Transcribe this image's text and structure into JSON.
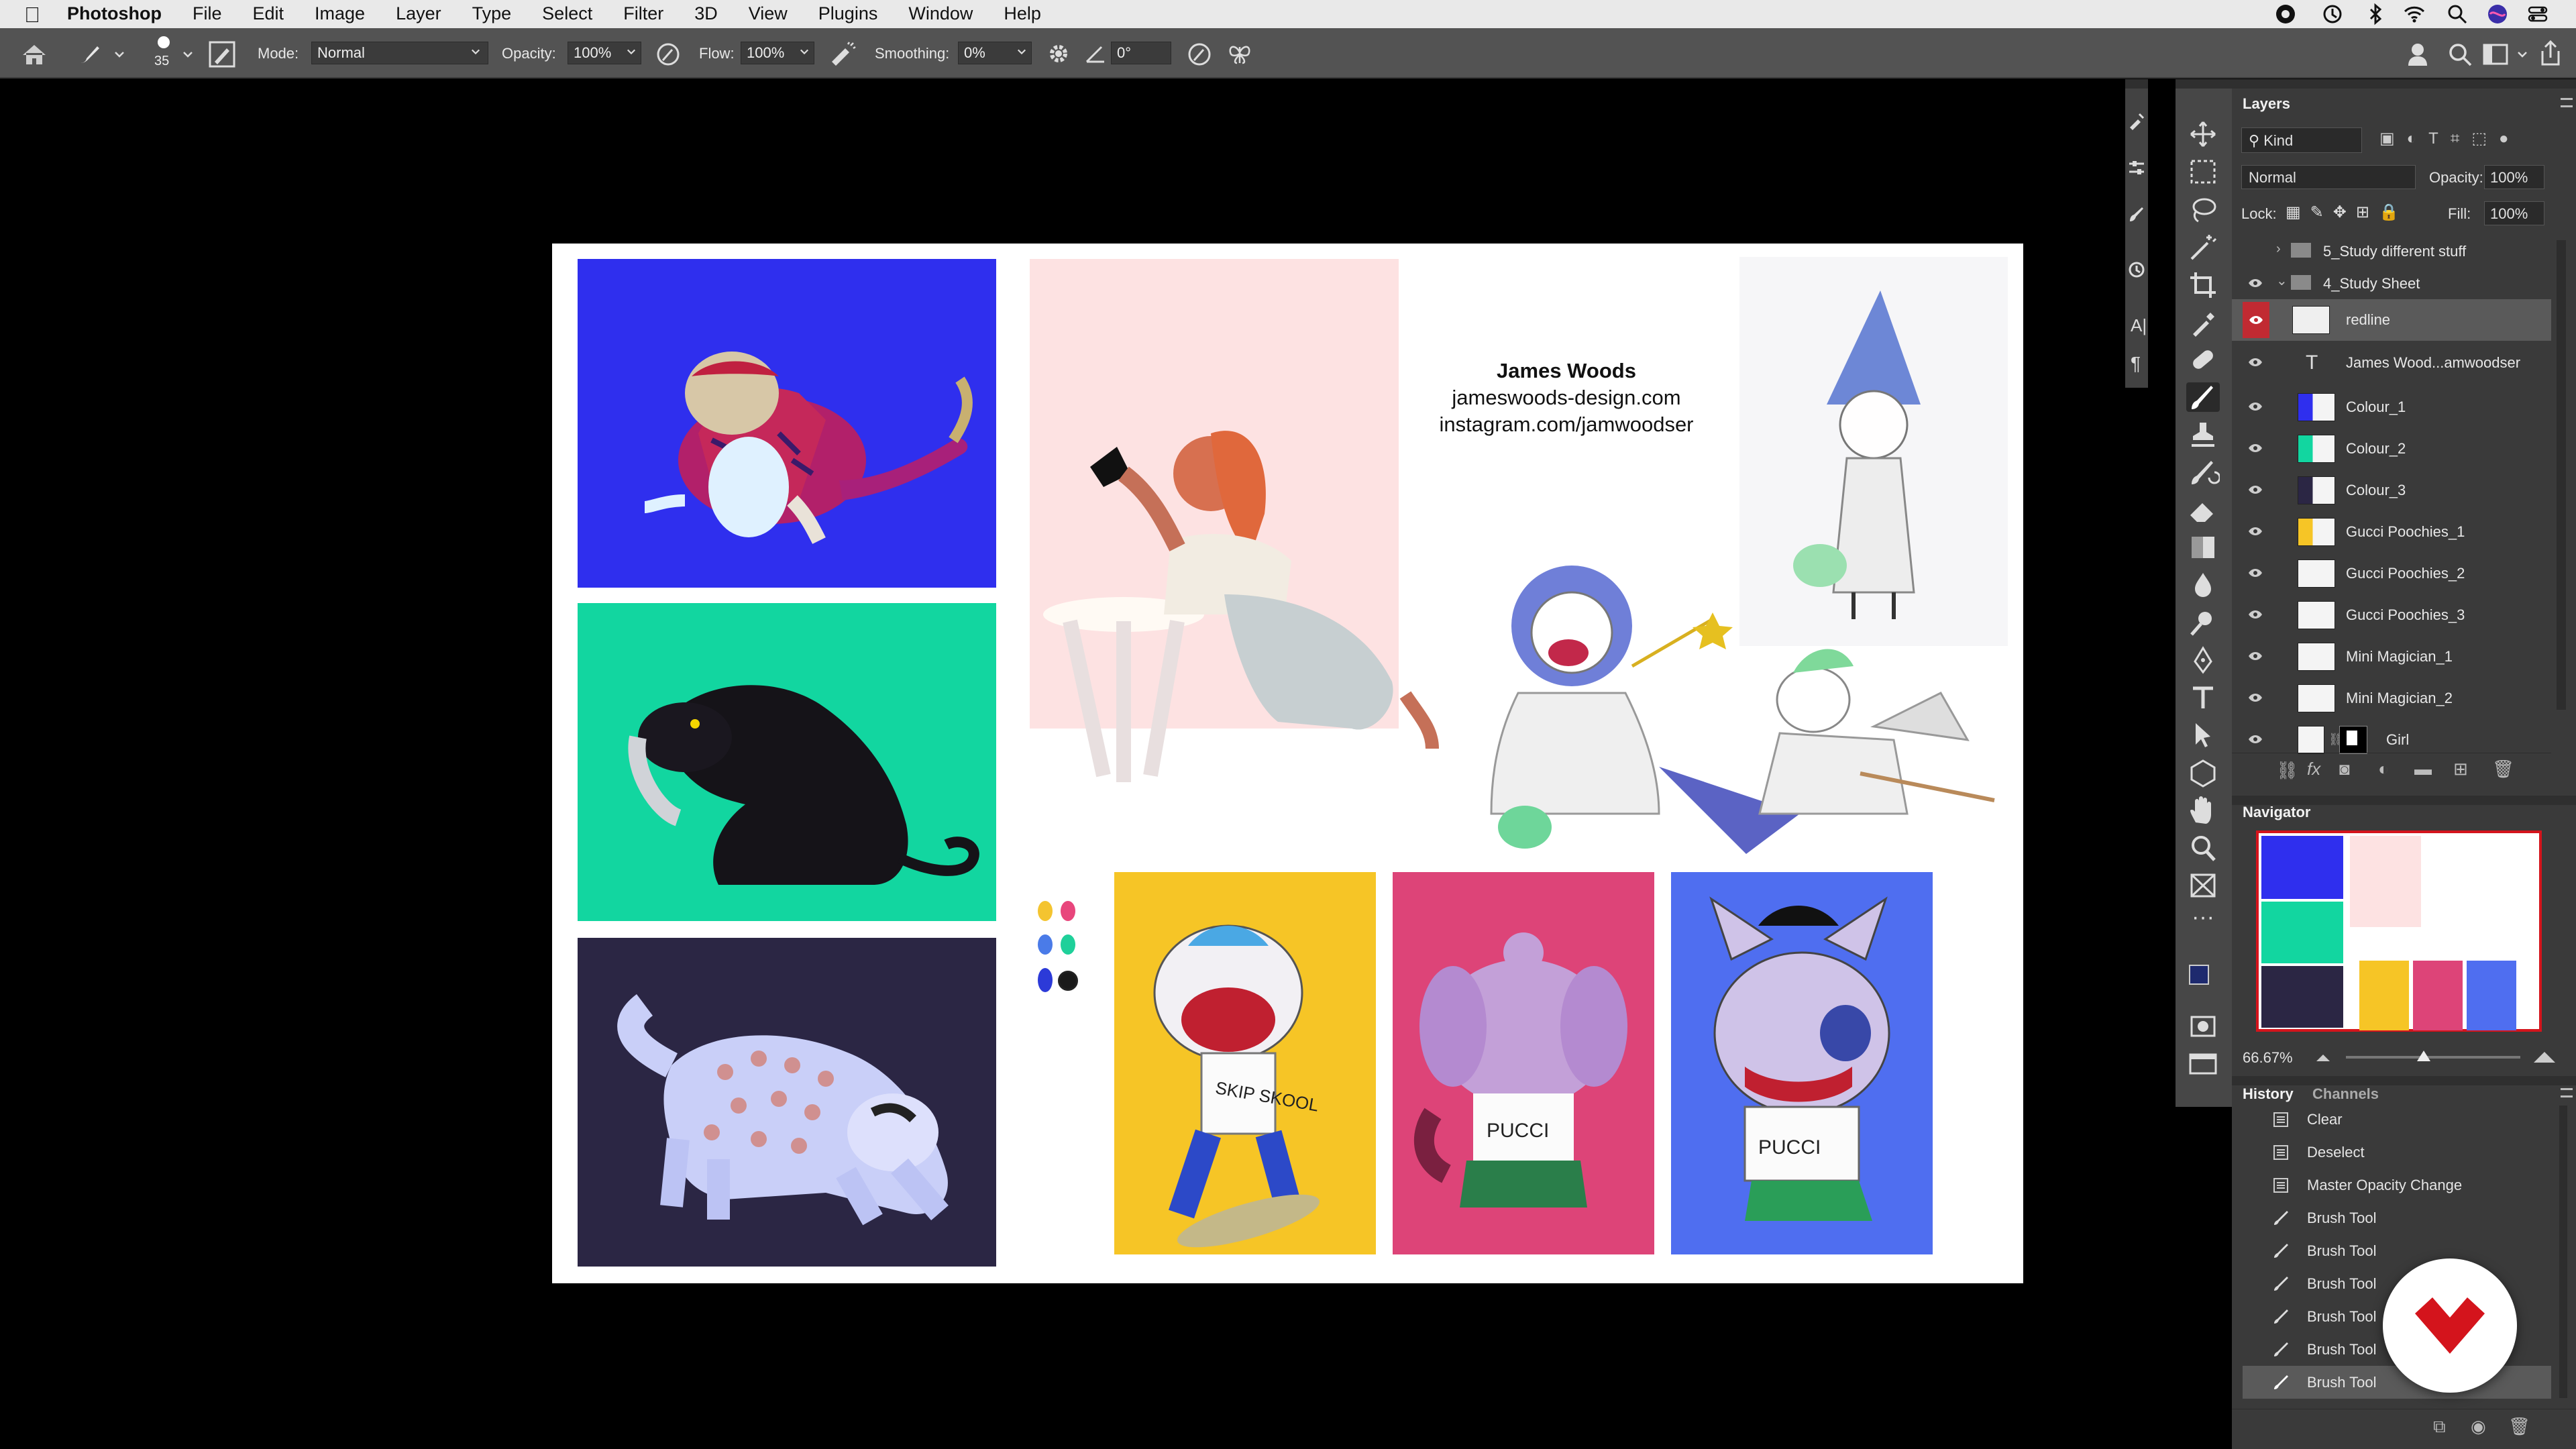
{
  "menubar": {
    "app": "Photoshop",
    "items": [
      "File",
      "Edit",
      "Image",
      "Layer",
      "Type",
      "Select",
      "Filter",
      "3D",
      "View",
      "Plugins",
      "Window",
      "Help"
    ]
  },
  "options": {
    "brush_size": "35",
    "mode_label": "Mode:",
    "mode_value": "Normal",
    "opacity_label": "Opacity:",
    "opacity_value": "100%",
    "flow_label": "Flow:",
    "flow_value": "100%",
    "smoothing_label": "Smoothing:",
    "smoothing_value": "0%",
    "angle_value": "0°"
  },
  "document": {
    "artist_name": "James Woods",
    "website": "jameswoods-design.com",
    "instagram": "instagram.com/jamwoodser",
    "shirt_text_1": "SKIP SKOOL",
    "shirt_text_2": "PUCCI",
    "shirt_text_3": "PUCCI",
    "swatches": [
      "#f4c430",
      "#e8467c",
      "#4a7be8",
      "#1fd09a",
      "#2c3ad8",
      "#222222"
    ]
  },
  "layers_panel": {
    "title": "Layers",
    "filter_label": "Kind",
    "blend_mode": "Normal",
    "opacity_label": "Opacity:",
    "opacity_value": "100%",
    "lock_label": "Lock:",
    "fill_label": "Fill:",
    "fill_value": "100%",
    "layers": [
      {
        "name": "5_Study different stuff",
        "type": "group",
        "visible": false
      },
      {
        "name": "4_Study Sheet",
        "type": "group",
        "visible": true
      },
      {
        "name": "redline",
        "type": "pixel",
        "visible": true,
        "selected": true
      },
      {
        "name": "James Wood...amwoodser",
        "type": "text",
        "visible": true
      },
      {
        "name": "Colour_1",
        "type": "pixel",
        "visible": true
      },
      {
        "name": "Colour_2",
        "type": "pixel",
        "visible": true
      },
      {
        "name": "Colour_3",
        "type": "pixel",
        "visible": true
      },
      {
        "name": "Gucci Poochies_1",
        "type": "pixel",
        "visible": true
      },
      {
        "name": "Gucci Poochies_2",
        "type": "pixel",
        "visible": true
      },
      {
        "name": "Gucci Poochies_3",
        "type": "pixel",
        "visible": true
      },
      {
        "name": "Mini Magician_1",
        "type": "pixel",
        "visible": true
      },
      {
        "name": "Mini Magician_2",
        "type": "pixel",
        "visible": true
      },
      {
        "name": "Girl",
        "type": "masked",
        "visible": true
      }
    ]
  },
  "navigator": {
    "title": "Navigator",
    "zoom": "66.67%"
  },
  "history_panel": {
    "tab_history": "History",
    "tab_channels": "Channels",
    "states": [
      "Clear",
      "Deselect",
      "Master Opacity Change",
      "Brush Tool",
      "Brush Tool",
      "Brush Tool",
      "Brush Tool",
      "Brush Tool",
      "Brush Tool"
    ],
    "active_index": 8
  },
  "colors": {
    "foreground": "#1e2a6e",
    "background": "#ffffff",
    "accent_red": "#d4141c"
  }
}
